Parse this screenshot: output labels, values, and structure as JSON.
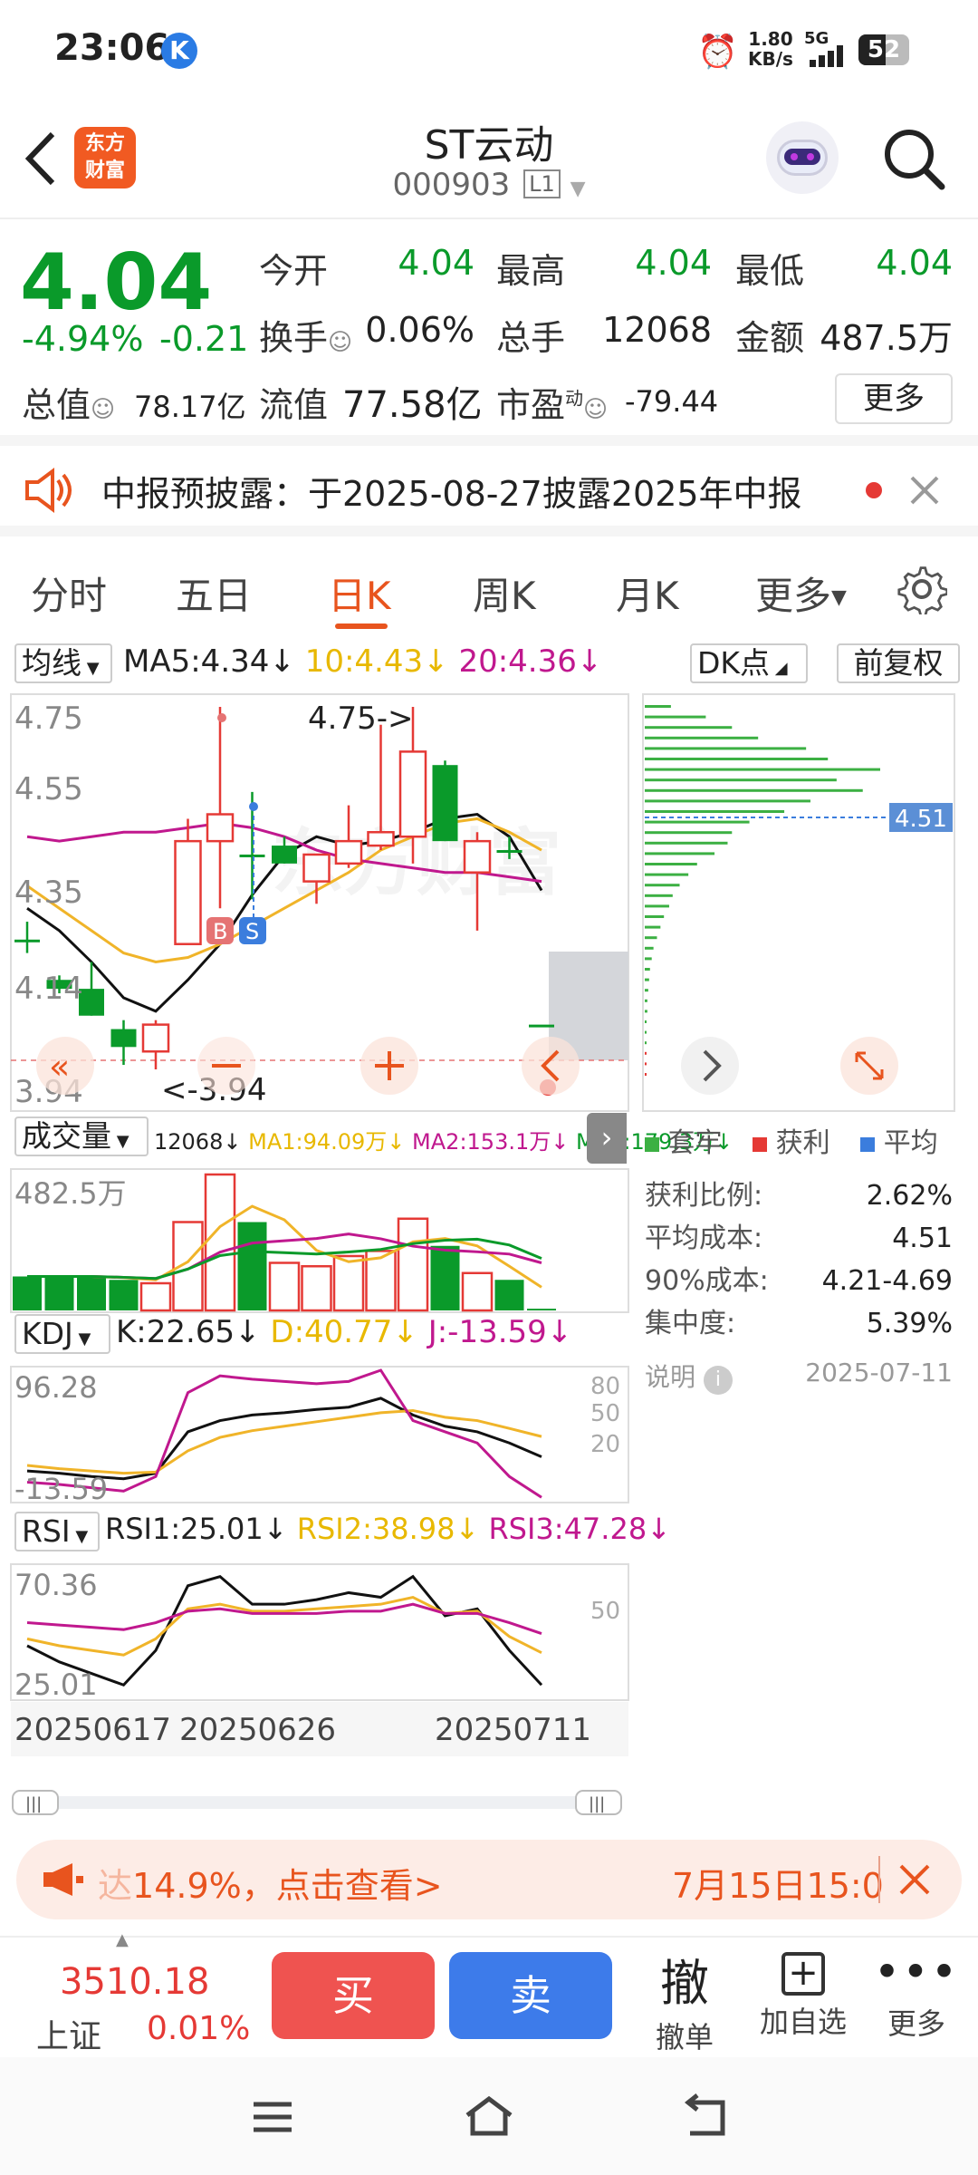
{
  "status": {
    "time": "23:06",
    "net_speed": "1.80",
    "net_unit": "KB/s",
    "network": "5G",
    "battery": "52"
  },
  "header": {
    "logo_line1": "东方",
    "logo_line2": "财富",
    "name": "ST云动",
    "code": "000903",
    "level": "L1"
  },
  "quote": {
    "price": "4.04",
    "change_pct": "-4.94%",
    "change": "-0.21",
    "open_label": "今开",
    "open": "4.04",
    "high_label": "最高",
    "high": "4.04",
    "low_label": "最低",
    "low": "4.04",
    "turnover_label": "换手",
    "turnover": "0.06%",
    "volume_label": "总手",
    "volume": "12068",
    "amount_label": "金额",
    "amount": "487.5万",
    "total_cap_label": "总值",
    "total_cap": "78.17亿",
    "float_cap_label": "流值",
    "float_cap": "77.58亿",
    "pe_label": "市盈",
    "pe_sup": "动",
    "pe": "-79.44",
    "more_button": "更多"
  },
  "notice": {
    "text": "中报预披露：于2025-08-27披露2025年中报"
  },
  "tabs": [
    "分时",
    "五日",
    "日K",
    "周K",
    "月K",
    "更多"
  ],
  "kline_toolbar": {
    "ma_selector": "均线",
    "ma5": "MA5:4.34",
    "ma10": "10:4.43",
    "ma20": "20:4.36",
    "dk_button": "DK点",
    "adjust_button": "前复权",
    "arrow": "↓"
  },
  "kline_axis": {
    "y1": "4.75",
    "y2": "4.55",
    "y3": "4.35",
    "y4": "4.14",
    "y5": "3.94",
    "max_annot": "4.75->",
    "min_annot": "<-3.94",
    "buy_mark": "B",
    "sell_mark": "S"
  },
  "chip": {
    "price_tag": "4.51",
    "legend_trapped": "套牢",
    "legend_profit": "获利",
    "legend_avg": "平均",
    "profit_ratio_label": "获利比例:",
    "profit_ratio": "2.62%",
    "avg_cost_label": "平均成本:",
    "avg_cost": "4.51",
    "cost90_label": "90%成本:",
    "cost90": "4.21-4.69",
    "concentration_label": "集中度:",
    "concentration": "5.39%",
    "explain_label": "说明",
    "date": "2025-07-11"
  },
  "volume": {
    "selector": "成交量",
    "vol": "12068",
    "ma1": "MA1:94.09万",
    "ma2": "MA2:153.1万",
    "ma3": "MA3:179.3万",
    "axis_max": "482.5万"
  },
  "kdj": {
    "selector": "KDJ",
    "k": "K:22.65",
    "d": "D:40.77",
    "j": "J:-13.59",
    "axis_max": "96.28",
    "axis_min": "-13.59",
    "r80": "80",
    "r50": "50",
    "r20": "20"
  },
  "rsi": {
    "selector": "RSI",
    "rsi1": "RSI1:25.01",
    "rsi2": "RSI2:38.98",
    "rsi3": "RSI3:47.28",
    "axis_max": "70.36",
    "axis_min": "25.01",
    "r50": "50"
  },
  "dates": [
    "20250617",
    "20250626",
    "20250711"
  ],
  "ad": {
    "prefix": "达",
    "text": "14.9%，点击查看>",
    "time": "7月15日15:0"
  },
  "bottom": {
    "index_value": "3510.18",
    "index_name": "上证",
    "index_change": "0.01%",
    "buy": "买",
    "sell": "卖",
    "cancel_big": "撤",
    "cancel": "撤单",
    "add_watch": "加自选",
    "more": "更多"
  },
  "chart_data": {
    "type": "candlestick",
    "candles": [
      {
        "o": 4.23,
        "c": 4.23,
        "h": 4.27,
        "l": 4.2,
        "color": "green"
      },
      {
        "o": 4.14,
        "c": 4.12,
        "h": 4.15,
        "l": 4.11,
        "color": "green"
      },
      {
        "o": 4.12,
        "c": 4.06,
        "h": 4.18,
        "l": 4.06,
        "color": "green"
      },
      {
        "o": 4.03,
        "c": 3.99,
        "h": 4.05,
        "l": 3.95,
        "color": "green"
      },
      {
        "o": 3.98,
        "c": 4.04,
        "h": 4.05,
        "l": 3.94,
        "color": "red"
      },
      {
        "o": 4.22,
        "c": 4.45,
        "h": 4.5,
        "l": 4.22,
        "color": "red"
      },
      {
        "o": 4.45,
        "c": 4.51,
        "h": 4.75,
        "l": 4.3,
        "color": "red"
      },
      {
        "o": 4.42,
        "c": 4.42,
        "h": 4.56,
        "l": 4.32,
        "color": "green"
      },
      {
        "o": 4.44,
        "c": 4.4,
        "h": 4.46,
        "l": 4.4,
        "color": "green"
      },
      {
        "o": 4.36,
        "c": 4.42,
        "h": 4.42,
        "l": 4.31,
        "color": "red"
      },
      {
        "o": 4.4,
        "c": 4.45,
        "h": 4.53,
        "l": 4.39,
        "color": "red"
      },
      {
        "o": 4.44,
        "c": 4.47,
        "h": 4.71,
        "l": 4.43,
        "color": "red"
      },
      {
        "o": 4.46,
        "c": 4.65,
        "h": 4.75,
        "l": 4.4,
        "color": "red"
      },
      {
        "o": 4.62,
        "c": 4.45,
        "h": 4.63,
        "l": 4.45,
        "color": "green"
      },
      {
        "o": 4.38,
        "c": 4.45,
        "h": 4.47,
        "l": 4.25,
        "color": "red"
      },
      {
        "o": 4.43,
        "c": 4.43,
        "h": 4.46,
        "l": 4.41,
        "color": "green"
      },
      {
        "o": 4.04,
        "c": 4.04,
        "h": 4.04,
        "l": 4.04,
        "color": "green"
      }
    ],
    "ma5": [
      4.3,
      4.25,
      4.18,
      4.1,
      4.07,
      4.14,
      4.22,
      4.33,
      4.42,
      4.46,
      4.44,
      4.45,
      4.47,
      4.5,
      4.51,
      4.46,
      4.34
    ],
    "ma10": [
      4.35,
      4.3,
      4.25,
      4.2,
      4.18,
      4.19,
      4.22,
      4.26,
      4.3,
      4.34,
      4.38,
      4.43,
      4.46,
      4.49,
      4.5,
      4.47,
      4.43
    ],
    "ma20": [
      4.46,
      4.45,
      4.46,
      4.47,
      4.47,
      4.48,
      4.49,
      4.48,
      4.46,
      4.43,
      4.41,
      4.4,
      4.39,
      4.38,
      4.38,
      4.37,
      4.36
    ],
    "ylim": [
      3.94,
      4.75
    ],
    "volumes": [
      100,
      100,
      100,
      90,
      80,
      260,
      400,
      260,
      140,
      130,
      160,
      175,
      270,
      190,
      110,
      90,
      5
    ],
    "volume_colors": [
      "green",
      "green",
      "green",
      "green",
      "red",
      "red",
      "red",
      "green",
      "red",
      "red",
      "red",
      "red",
      "red",
      "green",
      "red",
      "green",
      "green"
    ],
    "kdj_k": [
      10,
      8,
      5,
      3,
      8,
      45,
      55,
      60,
      62,
      65,
      67,
      75,
      60,
      50,
      45,
      35,
      22.65
    ],
    "kdj_d": [
      15,
      12,
      10,
      8,
      9,
      28,
      40,
      46,
      50,
      54,
      58,
      62,
      64,
      58,
      55,
      48,
      40.77
    ],
    "kdj_j": [
      0,
      -2,
      -5,
      -8,
      5,
      80,
      95,
      92,
      90,
      88,
      90,
      100,
      55,
      45,
      35,
      5,
      -13.59
    ],
    "rsi1": [
      42,
      35,
      30,
      25,
      40,
      68,
      72,
      60,
      60,
      62,
      65,
      63,
      72,
      55,
      58,
      40,
      25.01
    ],
    "rsi2": [
      45,
      42,
      40,
      38,
      45,
      58,
      60,
      57,
      57,
      58,
      59,
      60,
      63,
      56,
      57,
      46,
      38.98
    ],
    "rsi3": [
      52,
      51,
      50,
      49,
      52,
      57,
      58,
      56,
      56,
      56,
      57,
      57,
      60,
      56,
      56,
      52,
      47.28
    ],
    "chip_price_levels_top": 4.75,
    "chip_bars": [
      30,
      70,
      100,
      130,
      185,
      210,
      270,
      220,
      250,
      190,
      160,
      120,
      100,
      95,
      80,
      60,
      50,
      40,
      32,
      28,
      22,
      18,
      14,
      10,
      8,
      6,
      5,
      4,
      3,
      3,
      2,
      2,
      2,
      1,
      1,
      1
    ]
  }
}
